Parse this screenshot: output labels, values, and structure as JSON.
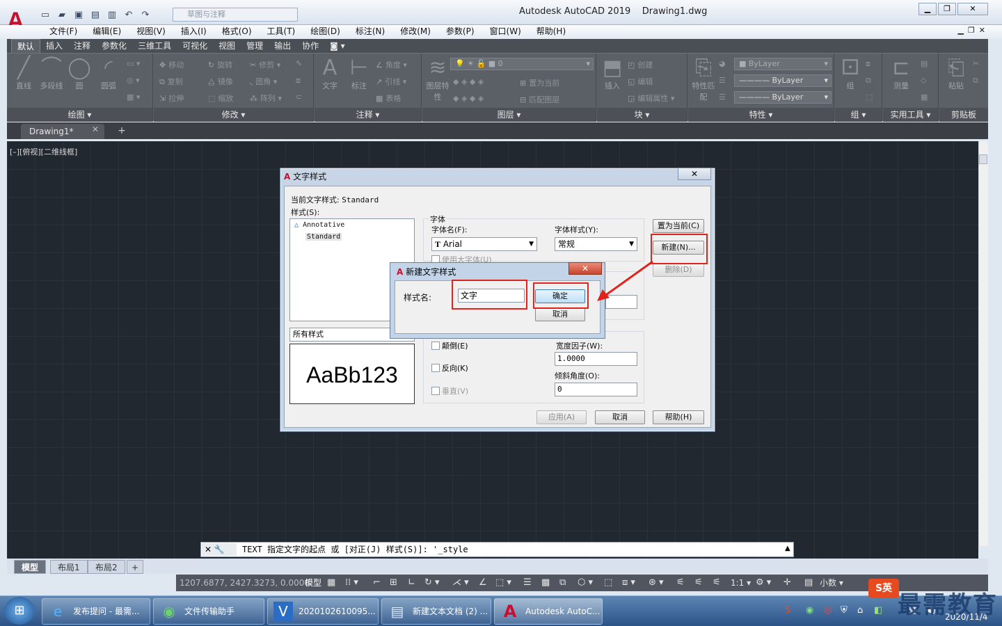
{
  "app": {
    "title": "Autodesk AutoCAD 2019",
    "file": "Drawing1.dwg",
    "workspace": "草图与注释",
    "logo": "A"
  },
  "menus": [
    "文件(F)",
    "编辑(E)",
    "视图(V)",
    "插入(I)",
    "格式(O)",
    "工具(T)",
    "绘图(D)",
    "标注(N)",
    "修改(M)",
    "参数(P)",
    "窗口(W)",
    "帮助(H)"
  ],
  "ribbon_tabs": [
    "默认",
    "插入",
    "注释",
    "参数化",
    "三维工具",
    "可视化",
    "视图",
    "管理",
    "输出",
    "协作"
  ],
  "ribbon": {
    "draw": {
      "title": "绘图",
      "line": "直线",
      "polyline": "多段线",
      "circle": "圆",
      "arc": "圆弧"
    },
    "modify": {
      "title": "修改",
      "move": "移动",
      "rotate": "旋转",
      "trim": "修剪",
      "copy": "复制",
      "mirror": "镜像",
      "fillet": "圆角",
      "stretch": "拉伸",
      "scale": "缩放",
      "array": "阵列"
    },
    "annotation": {
      "title": "注释",
      "text": "文字",
      "dimension": "标注",
      "angle": "角度",
      "leader": "引线",
      "table": "表格"
    },
    "layers": {
      "title": "图层",
      "layer_props": "图层特性",
      "current_layer": "0",
      "set_current": "置为当前",
      "match": "匹配图层"
    },
    "block": {
      "title": "块",
      "insert": "插入",
      "create": "创建",
      "edit": "编辑",
      "edit_attr": "编辑属性"
    },
    "properties": {
      "title": "特性",
      "match": "特性匹配",
      "bylayer1": "ByLayer",
      "bylayer2": "ByLayer",
      "bylayer3": "ByLayer"
    },
    "groups": {
      "title": "组",
      "group": "组"
    },
    "utilities": {
      "title": "实用工具",
      "measure": "测量"
    },
    "clipboard": {
      "title": "剪贴板",
      "paste": "粘贴"
    }
  },
  "doc_tab": "Drawing1*",
  "viewport_label": "[–][俯视][二维线框]",
  "text_style_dialog": {
    "title": "文字样式",
    "current_style_label": "当前文字样式:",
    "current_style": "Standard",
    "styles_label": "样式(S):",
    "styles": [
      "Annotative",
      "Standard"
    ],
    "filter": "所有样式",
    "preview": "AaBb123",
    "font_group": "字体",
    "font_name_label": "字体名(F):",
    "font_name": "Arial",
    "font_style_label": "字体样式(Y):",
    "font_style": "常规",
    "big_font_label": "使用大字体(U)",
    "upside_down": "颠倒(E)",
    "backwards": "反向(K)",
    "vertical": "垂直(V)",
    "width_factor_label": "宽度因子(W):",
    "width_factor": "1.0000",
    "oblique_label": "倾斜角度(O):",
    "oblique": "0",
    "set_current": "置为当前(C)",
    "new": "新建(N)...",
    "delete": "删除(D)",
    "apply": "应用(A)",
    "cancel": "取消",
    "help": "帮助(H)",
    "close": "✕"
  },
  "new_style_dialog": {
    "title": "新建文字样式",
    "name_label": "样式名:",
    "name_value": "文字",
    "ok": "确定",
    "cancel": "取消",
    "close": "✕"
  },
  "command_line": {
    "text": "TEXT 指定文字的起点 或 [对正(J) 样式(S)]: '_style"
  },
  "layout_tabs": [
    "模型",
    "布局1",
    "布局2"
  ],
  "status": {
    "coords": "1207.6877, 2427.3273, 0.0000",
    "model": "模型",
    "scale": "1:1",
    "units": "小数"
  },
  "taskbar": {
    "tasks": [
      "发布提问 - 最需...",
      "文件传输助手",
      "2020102610095...",
      "新建文本文档 (2) ...",
      "Autodesk AutoC..."
    ],
    "date": "2020/11/4",
    "ime": "英"
  },
  "watermark": "最需教育"
}
